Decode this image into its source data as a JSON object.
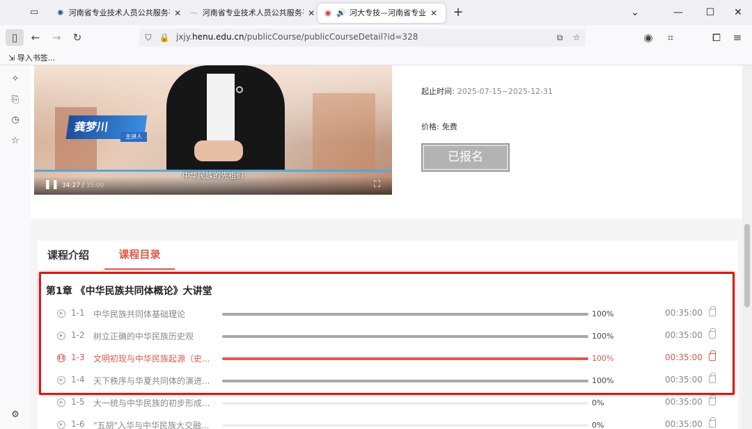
{
  "browser": {
    "tabs": [
      {
        "title": "河南省专业技术人员公共服务平",
        "favicon": "gov-emblem-icon"
      },
      {
        "title": "河南省专业技术人员公共服务平",
        "favicon": "wheat-logo-icon"
      },
      {
        "title": "河大专技—河南省专业技术",
        "favicon": "henu-logo-icon",
        "audio": true
      }
    ],
    "url": {
      "prefix": "jxjy.",
      "host": "henu.edu.cn",
      "path": "/publicCourse/publicCourseDetail?id=328"
    },
    "bookmark_label": "导入书签..."
  },
  "video": {
    "speaker_name": "龚梦川",
    "speaker_role": "主讲人",
    "subtitle": "中华民族的先祖们",
    "current_time": "34:27",
    "duration": "35:00"
  },
  "course_meta": {
    "period_label": "起止时间:",
    "period_value": "2025-07-15~2025-12-31",
    "price_label": "价格:",
    "price_value": "免费",
    "enrolled_button": "已报名"
  },
  "catalog": {
    "tabs": {
      "intro": "课程介绍",
      "catalog": "课程目录"
    },
    "chapter_title": "第1章 《中华民族共同体概论》大讲堂",
    "lessons": [
      {
        "num": "1-1",
        "name": "中华民族共同体基础理论",
        "progress": 1.0,
        "pct": "100%",
        "duration": "00:35:00"
      },
      {
        "num": "1-2",
        "name": "树立正确的中华民族历史观",
        "progress": 1.0,
        "pct": "100%",
        "duration": "00:35:00"
      },
      {
        "num": "1-3",
        "name": "文明初现与中华民族起源（史...",
        "progress": 1.0,
        "pct": "100%",
        "duration": "00:35:00",
        "active": true
      },
      {
        "num": "1-4",
        "name": "天下秩序与华夏共同体的演进...",
        "progress": 1.0,
        "pct": "100%",
        "duration": "00:35:00"
      },
      {
        "num": "1-5",
        "name": "大一统与中华民族的初步形成...",
        "progress": 0.0,
        "pct": "0%",
        "duration": "00:35:00"
      },
      {
        "num": "1-6",
        "name": "\"五胡\"入华与中华民族大交融...",
        "progress": 0.0,
        "pct": "0%",
        "duration": "00:35:00"
      }
    ]
  },
  "colors": {
    "accent": "#e0584a",
    "highlight": "#d01c1c"
  }
}
